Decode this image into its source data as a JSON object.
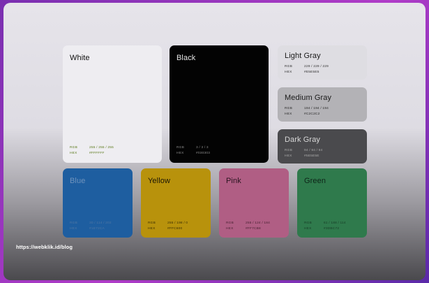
{
  "url": "https://webklik.id/blog",
  "labels": {
    "rgb": "RGB",
    "hex": "HEX"
  },
  "swatches": {
    "white": {
      "name": "White",
      "rgb": "255 / 255 / 255",
      "hex": "#FFFFFF",
      "color": "#f2f2f4"
    },
    "black": {
      "name": "Black",
      "rgb": "3 / 3 / 3",
      "hex": "#030303",
      "color": "#030303"
    },
    "light_gray": {
      "name": "Light Gray",
      "rgb": "229 / 229 / 229",
      "hex": "#E5E5E5",
      "color": "#e5e5e5"
    },
    "medium_gray": {
      "name": "Medium Gray",
      "rgb": "194 / 194 / 194",
      "hex": "#C2C2C2",
      "color": "#c2c2c2"
    },
    "dark_gray": {
      "name": "Dark Gray",
      "rgb": "94 / 94 / 94",
      "hex": "#5E5E5E",
      "color": "#5e5e5e"
    },
    "blue": {
      "name": "Blue",
      "rgb": "30 / 114 / 202",
      "hex": "#1E72CA",
      "color": "#1e72ca"
    },
    "yellow": {
      "name": "Yellow",
      "rgb": "255 / 198 / 0",
      "hex": "#FFC600",
      "color": "#ffc600"
    },
    "pink": {
      "name": "Pink",
      "rgb": "255 / 124 / 184",
      "hex": "#FF7CB8",
      "color": "#ff7cb8"
    },
    "green": {
      "name": "Green",
      "rgb": "61 / 188 / 114",
      "hex": "#3DBC72",
      "color": "#3dbc72"
    }
  }
}
